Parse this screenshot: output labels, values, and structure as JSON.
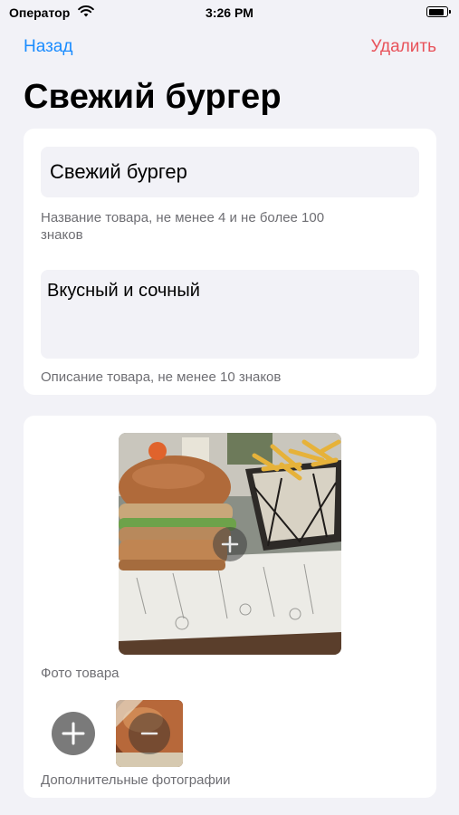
{
  "status_bar": {
    "carrier": "Оператор",
    "time": "3:26 PM",
    "battery_level": 0.85
  },
  "nav": {
    "back_label": "Назад",
    "delete_label": "Удалить"
  },
  "page": {
    "title": "Свежий бургер"
  },
  "form": {
    "name_value": "Свежий бургер",
    "name_hint": "Название товара, не менее 4 и не более 100 знаков",
    "description_value": "Вкусный и сочный",
    "description_hint": "Описание товара, не менее 10 знаков"
  },
  "photos": {
    "main_caption": "Фото товара",
    "extra_caption": "Дополнительные фотографии"
  },
  "colors": {
    "accent": "#1a8cff",
    "destructive": "#e8525a",
    "background": "#f2f2f7"
  },
  "icons": [
    "wifi-icon",
    "battery-icon",
    "plus-icon",
    "minus-icon"
  ]
}
